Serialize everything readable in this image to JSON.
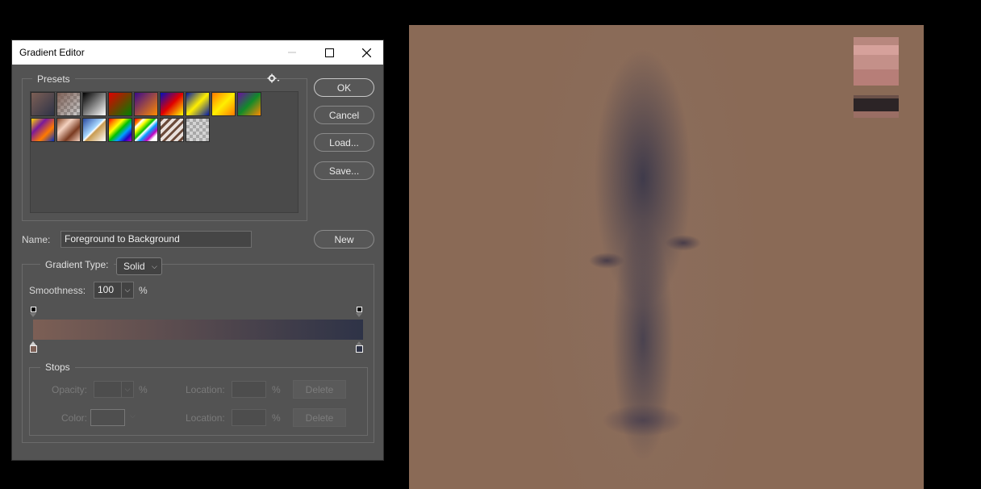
{
  "dialog": {
    "title": "Gradient Editor",
    "presets_label": "Presets",
    "gear_icon": "gear-icon",
    "buttons": {
      "ok": "OK",
      "cancel": "Cancel",
      "load": "Load...",
      "save": "Save...",
      "new": "New"
    },
    "name_label": "Name:",
    "name_value": "Foreground to Background",
    "gradient_type_label": "Gradient Type:",
    "gradient_type_value": "Solid",
    "smoothness_label": "Smoothness:",
    "smoothness_value": "100",
    "smoothness_unit": "%",
    "stops": {
      "label": "Stops",
      "opacity_label": "Opacity:",
      "opacity_unit": "%",
      "opacity_location_label": "Location:",
      "opacity_location_unit": "%",
      "opacity_delete": "Delete",
      "color_label": "Color:",
      "color_location_label": "Location:",
      "color_location_unit": "%",
      "color_delete": "Delete"
    },
    "gradient_colors": {
      "start": "#7c5f55",
      "end": "#2e3347"
    }
  },
  "presets": [
    "foreground-to-background",
    "foreground-to-transparent",
    "black-white",
    "red-green",
    "violet-orange",
    "blue-red-yellow",
    "blue-yellow-blue",
    "orange-yellow-orange",
    "violet-green-orange",
    "yellow-violet-orange-blue",
    "copper",
    "chrome",
    "spectrum",
    "transparent-rainbow",
    "transparent-stripes",
    "neutral-density"
  ],
  "canvas": {
    "base_color": "#8a6a56"
  }
}
